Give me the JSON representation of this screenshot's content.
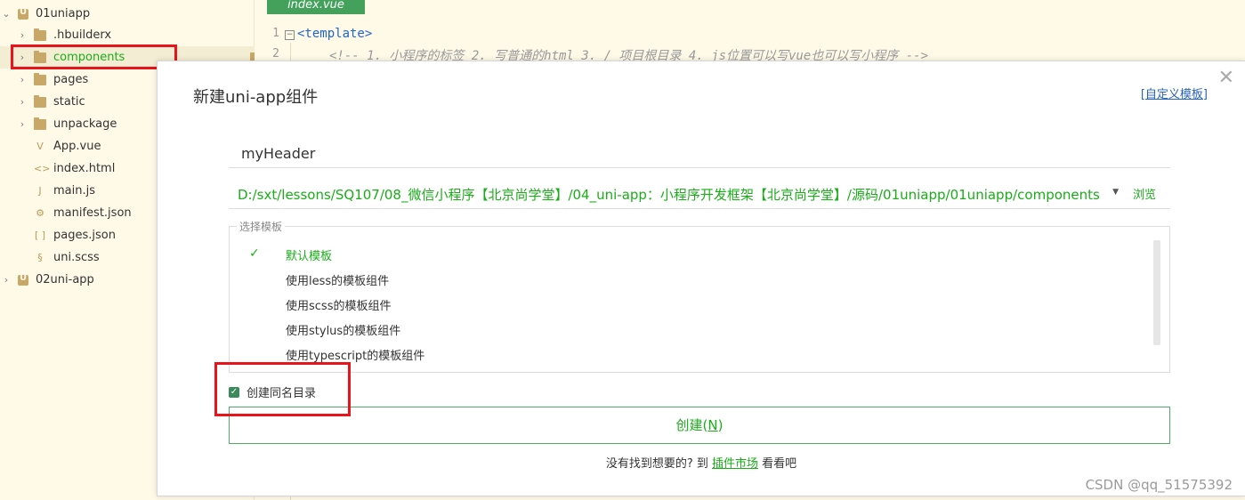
{
  "sidebar": {
    "items": [
      {
        "label": "01uniapp",
        "kind": "project",
        "expanded": true
      },
      {
        "label": ".hbuilderx",
        "kind": "folder"
      },
      {
        "label": "components",
        "kind": "folder"
      },
      {
        "label": "pages",
        "kind": "folder"
      },
      {
        "label": "static",
        "kind": "folder"
      },
      {
        "label": "unpackage",
        "kind": "folder"
      },
      {
        "label": "App.vue",
        "kind": "file",
        "icon": "vue-file-icon"
      },
      {
        "label": "index.html",
        "kind": "file",
        "icon": "html-file-icon"
      },
      {
        "label": "main.js",
        "kind": "file",
        "icon": "js-file-icon"
      },
      {
        "label": "manifest.json",
        "kind": "file",
        "icon": "json-config-icon"
      },
      {
        "label": "pages.json",
        "kind": "file",
        "icon": "json-file-icon"
      },
      {
        "label": "uni.scss",
        "kind": "file",
        "icon": "scss-file-icon"
      },
      {
        "label": "02uni-app",
        "kind": "project",
        "expanded": false
      }
    ]
  },
  "editor": {
    "tab": "index.vue",
    "lines": [
      {
        "num": "1",
        "text": "<template>"
      },
      {
        "num": "2",
        "text": "<!-- 1. 小程序的标签  2. 写普通的html  3. / 项目根目录  4. js位置可以写vue也可以写小程序 -->"
      }
    ]
  },
  "dialog": {
    "title": "新建uni-app组件",
    "custom_template": "[自定义模板]",
    "name_value": "myHeader",
    "path": "D:/sxt/lessons/SQ107/08_微信小程序【北京尚学堂】/04_uni-app：小程序开发框架【北京尚学堂】/源码/01uniapp/01uniapp/components",
    "browse": "浏览",
    "template_legend": "选择模板",
    "templates": [
      "默认模板",
      "使用less的模板组件",
      "使用scss的模板组件",
      "使用stylus的模板组件",
      "使用typescript的模板组件"
    ],
    "selected_template_index": 0,
    "mkdir_label": "创建同名目录",
    "mkdir_checked": true,
    "create_label": "创建(",
    "create_hotkey": "N",
    "create_suffix": ")",
    "footer_prefix": "没有找到想要的? 到 ",
    "footer_link": "插件市场",
    "footer_suffix": " 看看吧"
  },
  "watermark": "CSDN @qq_51575392",
  "colors": {
    "accent_green": "#1aad19",
    "editor_bg": "#fffae8",
    "highlight_red": "#e8131b",
    "link_blue": "#2a63b8"
  }
}
